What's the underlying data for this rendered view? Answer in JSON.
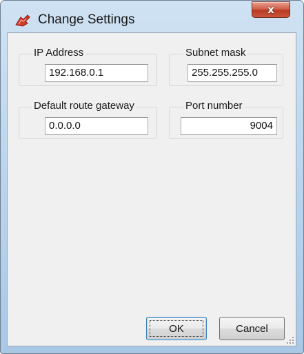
{
  "window": {
    "title": "Change Settings",
    "title_icon": "red-device-icon",
    "close_label": "x"
  },
  "groups": {
    "ip_address": {
      "label": "IP Address",
      "value": "192.168.0.1"
    },
    "subnet_mask": {
      "label": "Subnet mask",
      "value": "255.255.255.0"
    },
    "gateway": {
      "label": "Default route gateway",
      "value": "0.0.0.0"
    },
    "port": {
      "label": "Port number",
      "value": "9004"
    }
  },
  "buttons": {
    "ok_label": "OK",
    "cancel_label": "Cancel"
  },
  "colors": {
    "title_gradient_top": "#cfe2f3",
    "close_button_red": "#c9563d",
    "dialog_background": "#f0f0f0",
    "default_button_border": "#3c7fb1"
  }
}
